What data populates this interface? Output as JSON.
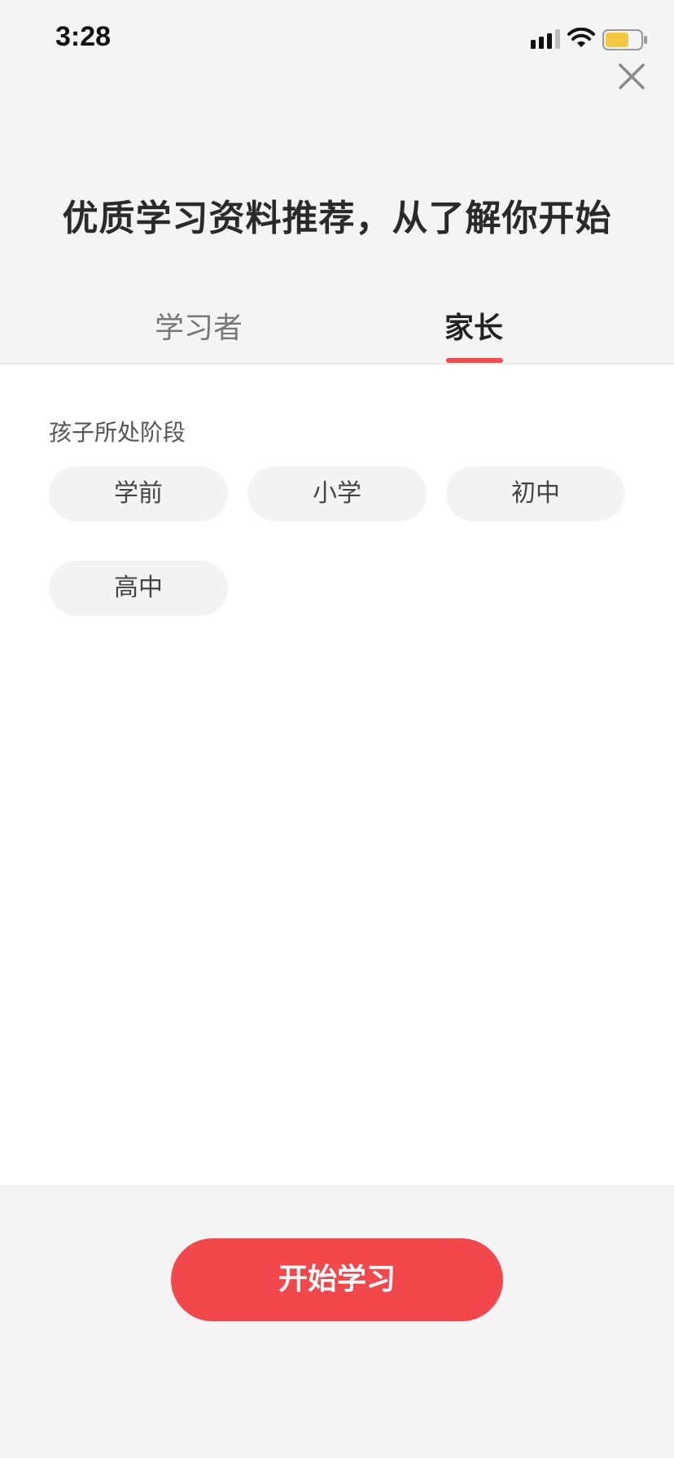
{
  "status_bar": {
    "time": "3:28"
  },
  "header": {
    "title": "优质学习资料推荐，从了解你开始"
  },
  "tabs": [
    {
      "label": "学习者",
      "selected": false
    },
    {
      "label": "家长",
      "selected": true
    }
  ],
  "section": {
    "label": "孩子所处阶段",
    "options": [
      {
        "label": "学前"
      },
      {
        "label": "小学"
      },
      {
        "label": "初中"
      },
      {
        "label": "高中"
      }
    ]
  },
  "footer": {
    "start_label": "开始学习"
  },
  "colors": {
    "accent": "#f04b4d",
    "button": "#f2474b",
    "battery": "#f5c842"
  },
  "icons": {
    "close": "close-icon",
    "signal": "signal-icon",
    "wifi": "wifi-icon",
    "battery": "battery-icon"
  }
}
